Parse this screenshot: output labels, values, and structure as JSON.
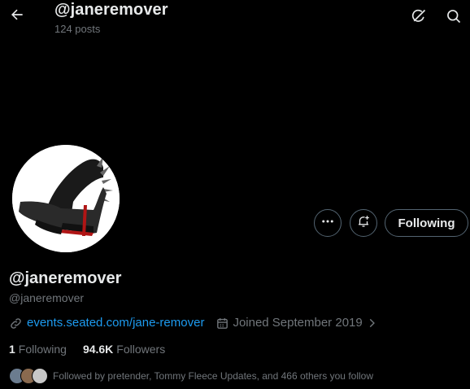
{
  "header": {
    "title": "@janeremover",
    "post_count": "124 posts"
  },
  "profile": {
    "display_name": "@janeremover",
    "handle": "@janeremover",
    "website": "events.seated.com/jane-remover",
    "joined": "Joined September 2019",
    "following_count": "1",
    "following_label": "Following",
    "followers_count": "94.6K",
    "followers_label": "Followers",
    "followed_by": "Followed by pretender, Tommy Fleece Updates, and 466 others you follow"
  },
  "actions": {
    "follow_button_label": "Following"
  },
  "icons": {
    "back": "back-arrow-icon",
    "grok": "grok-icon",
    "search": "search-icon",
    "more": "more-icon",
    "notify": "bell-plus-icon",
    "link": "link-icon",
    "calendar": "calendar-icon",
    "chevron": "chevron-right-icon"
  },
  "colors": {
    "background": "#000000",
    "text": "#e7e9ea",
    "muted": "#71767b",
    "link": "#1d9bf0",
    "border": "#536471"
  }
}
